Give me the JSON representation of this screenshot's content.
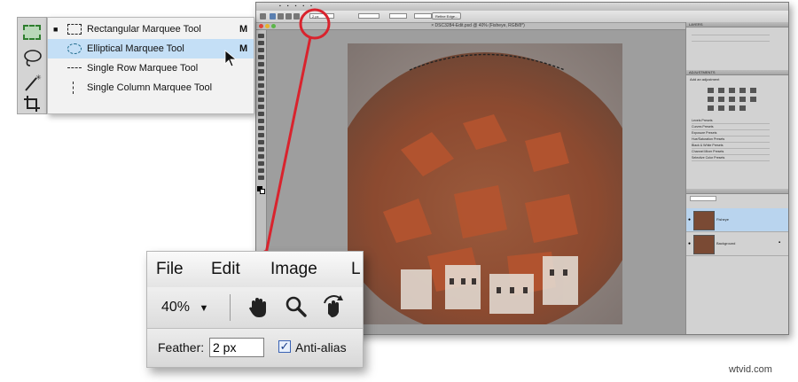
{
  "flyout": {
    "items": [
      {
        "label": "Rectangular Marquee Tool",
        "shortcut": "M",
        "icon": "rect-marquee-icon",
        "current": true
      },
      {
        "label": "Elliptical Marquee Tool",
        "shortcut": "M",
        "icon": "ellipse-marquee-icon",
        "highlighted": true
      },
      {
        "label": "Single Row Marquee Tool",
        "shortcut": "",
        "icon": "row-marquee-icon"
      },
      {
        "label": "Single Column Marquee Tool",
        "shortcut": "",
        "icon": "column-marquee-icon"
      }
    ]
  },
  "zoom_callout": {
    "menu": [
      "File",
      "Edit",
      "Image",
      "L"
    ],
    "zoom_level": "40%",
    "feather_label": "Feather:",
    "feather_value": "2 px",
    "antialias_label": "Anti-alias",
    "antialias_checked": true
  },
  "photoshop": {
    "doc_title": "× DSC3284-Edit.psd @ 40% (Fisheye, RGB/8*)",
    "options": {
      "feather_value": "2 px",
      "refine_button": "Refine Edge..."
    },
    "panels": {
      "layers_header": "LAYERS",
      "adjustments_header": "ADJUSTMENTS",
      "add_adjustment": "Add an adjustment",
      "presets": [
        "Levels Presets",
        "Curves Presets",
        "Exposure Presets",
        "Hue/Saturation Presets",
        "Black & White Presets",
        "Channel Mixer Presets",
        "Selective Color Presets"
      ],
      "layers": [
        {
          "name": "Fisheye",
          "selected": true
        },
        {
          "name": "Background",
          "locked": true
        }
      ]
    }
  },
  "colors": {
    "accent_red": "#d9232d",
    "highlight_blue": "#c4dff6",
    "selected_layer": "#b9d4ee"
  },
  "watermark": "wtvid.com"
}
